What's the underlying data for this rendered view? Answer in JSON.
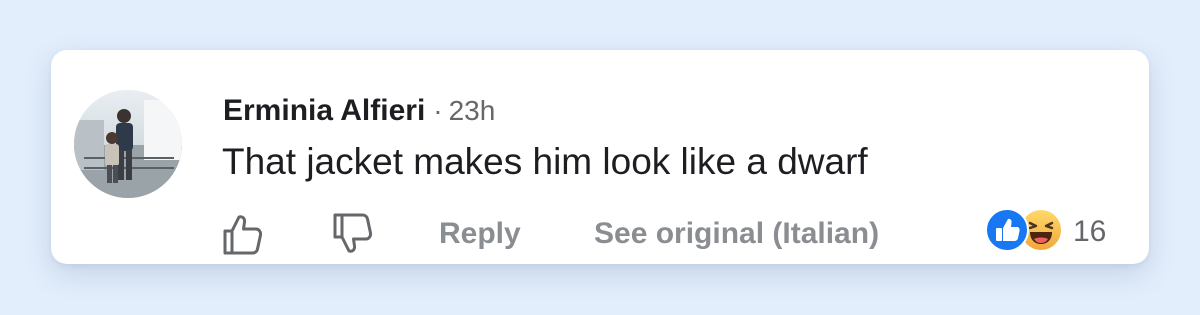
{
  "comment": {
    "author": "Erminia Alfieri",
    "separator": "·",
    "time": "23h",
    "text": "That jacket makes him look like a dwarf"
  },
  "actions": {
    "like_icon": "thumbs-up-outline-icon",
    "dislike_icon": "thumbs-down-outline-icon",
    "reply_label": "Reply",
    "see_original_label": "See original (Italian)"
  },
  "reactions": {
    "icons": [
      "like-reaction-icon",
      "haha-reaction-icon"
    ],
    "count": "16"
  },
  "colors": {
    "background": "#e2eefc",
    "card": "#ffffff",
    "text_primary": "#1c1e21",
    "text_secondary": "#65676b",
    "action_text": "#8a8d91",
    "like_blue": "#1877f2",
    "haha_yellow": "#f7c13d"
  }
}
